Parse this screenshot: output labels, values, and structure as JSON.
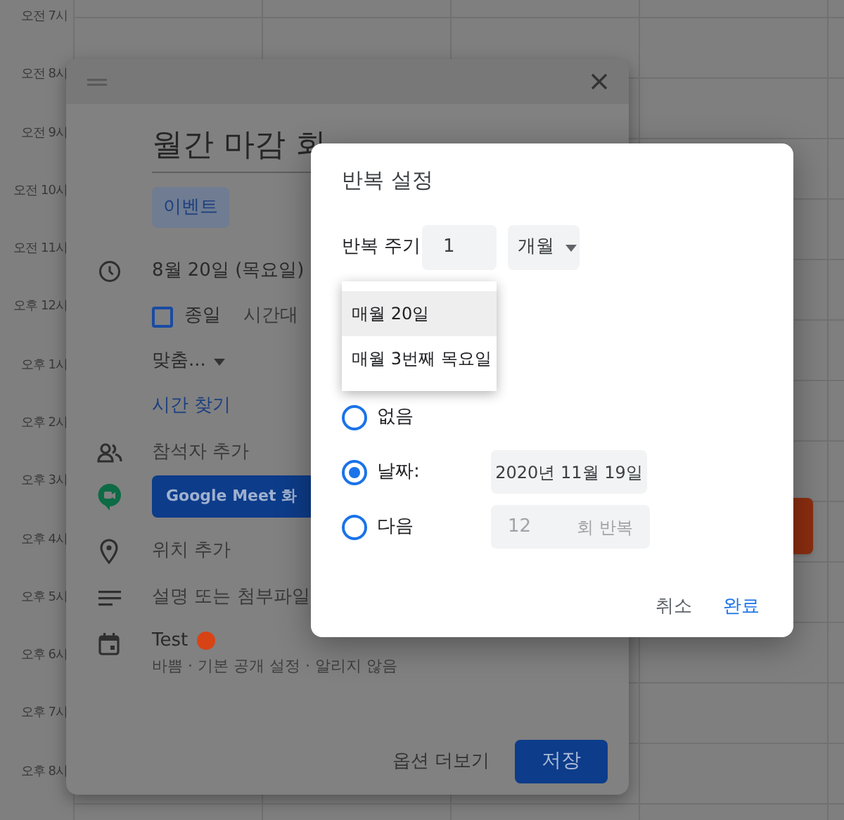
{
  "calendar": {
    "hours": [
      "오전 7시",
      "오전 8시",
      "오전 9시",
      "오전 10시",
      "오전 11시",
      "오후 12시",
      "오후 1시",
      "오후 2시",
      "오후 3시",
      "오후 4시",
      "오후 5시",
      "오후 6시",
      "오후 7시",
      "오후 8시"
    ]
  },
  "event_editor": {
    "title": "월간 마감 회",
    "type_tab": "이벤트",
    "date": "8월 20일 (목요일)",
    "all_day": {
      "label": "종일",
      "checked": false
    },
    "timezone": "시간대",
    "repeat": "맞춤...",
    "find_time": "시간 찾기",
    "guests": "참석자 추가",
    "meet_button": "Google Meet 화",
    "location": "위치 추가",
    "description": "설명 또는 첨부파일",
    "calendar": {
      "name": "Test",
      "color": "#d84315",
      "details": "바쁨 · 기본 공개 설정 · 알리지 않음"
    },
    "more_options": "옵션 더보기",
    "save": "저장"
  },
  "recurrence_dialog": {
    "title": "반복 설정",
    "interval_label": "반복 주기",
    "interval_value": "1",
    "unit": "개월",
    "menu": [
      {
        "label": "매월 20일",
        "selected": true
      },
      {
        "label": "매월 3번째 목요일",
        "selected": false
      }
    ],
    "end_options": [
      {
        "kind": "none",
        "label": "없음",
        "selected": false
      },
      {
        "kind": "date",
        "label": "날짜:",
        "selected": true,
        "value": "2020년 11월 19일"
      },
      {
        "kind": "count",
        "label": "다음",
        "selected": false,
        "value": "12",
        "suffix": "회 반복"
      }
    ],
    "buttons": [
      "취소",
      "완료"
    ]
  }
}
